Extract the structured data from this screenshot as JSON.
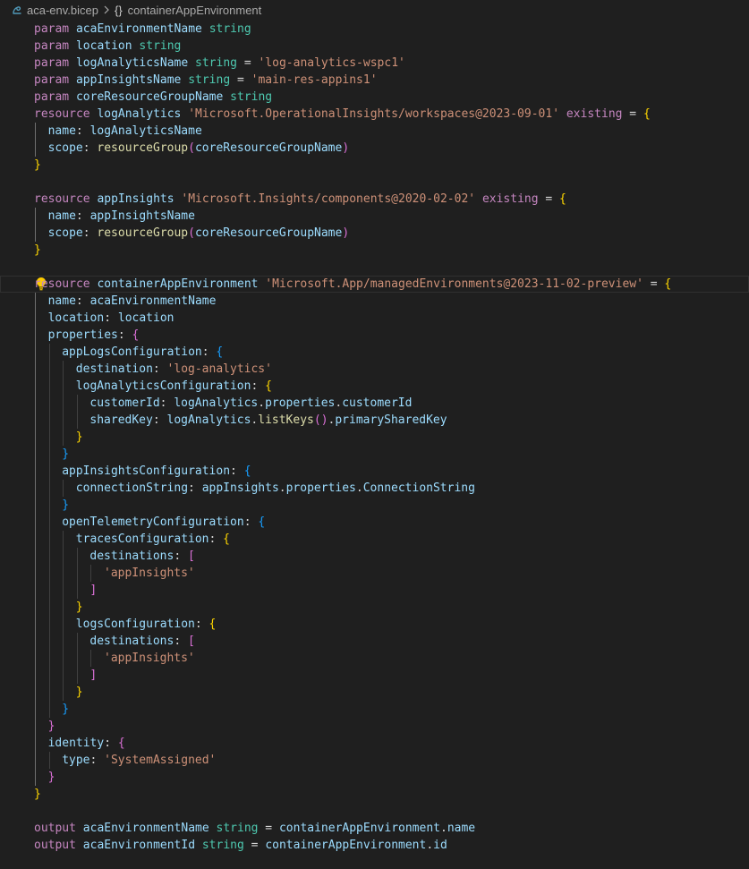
{
  "breadcrumb": {
    "file_icon": "bicep-file-icon",
    "file_name": "aca-env.bicep",
    "separator_icon": "chevron-right-icon",
    "symbol_icon_text": "{}",
    "symbol_name": "containerAppEnvironment"
  },
  "editor": {
    "theme_colors": {
      "background": "#1f1f1f",
      "keyword": "#C586C0",
      "identifier": "#9CDCFE",
      "type": "#4EC9B0",
      "string": "#CE9178",
      "function": "#DCDCAA",
      "bracket_gold": "#FFD700",
      "bracket_purple": "#DA70D6",
      "bracket_blue": "#179FFF"
    },
    "lightbulb_icon": "lightbulb-icon",
    "lines": [
      {
        "indent": 0,
        "tokens": [
          {
            "t": "param",
            "c": "kw"
          },
          {
            "t": " "
          },
          {
            "t": "acaEnvironmentName",
            "c": "id"
          },
          {
            "t": " "
          },
          {
            "t": "string",
            "c": "ty"
          }
        ]
      },
      {
        "indent": 0,
        "tokens": [
          {
            "t": "param",
            "c": "kw"
          },
          {
            "t": " "
          },
          {
            "t": "location",
            "c": "id"
          },
          {
            "t": " "
          },
          {
            "t": "string",
            "c": "ty"
          }
        ]
      },
      {
        "indent": 0,
        "tokens": [
          {
            "t": "param",
            "c": "kw"
          },
          {
            "t": " "
          },
          {
            "t": "logAnalyticsName",
            "c": "id"
          },
          {
            "t": " "
          },
          {
            "t": "string",
            "c": "ty"
          },
          {
            "t": " = ",
            "c": "op"
          },
          {
            "t": "'log-analytics-wspc1'",
            "c": "str"
          }
        ]
      },
      {
        "indent": 0,
        "tokens": [
          {
            "t": "param",
            "c": "kw"
          },
          {
            "t": " "
          },
          {
            "t": "appInsightsName",
            "c": "id"
          },
          {
            "t": " "
          },
          {
            "t": "string",
            "c": "ty"
          },
          {
            "t": " = ",
            "c": "op"
          },
          {
            "t": "'main-res-appins1'",
            "c": "str"
          }
        ]
      },
      {
        "indent": 0,
        "tokens": [
          {
            "t": "param",
            "c": "kw"
          },
          {
            "t": " "
          },
          {
            "t": "coreResourceGroupName",
            "c": "id"
          },
          {
            "t": " "
          },
          {
            "t": "string",
            "c": "ty"
          }
        ]
      },
      {
        "indent": 0,
        "tokens": [
          {
            "t": "resource",
            "c": "kw"
          },
          {
            "t": " "
          },
          {
            "t": "logAnalytics",
            "c": "id"
          },
          {
            "t": " "
          },
          {
            "t": "'Microsoft.OperationalInsights/workspaces@2023-09-01'",
            "c": "str"
          },
          {
            "t": " "
          },
          {
            "t": "existing",
            "c": "kw"
          },
          {
            "t": " = ",
            "c": "op"
          },
          {
            "t": "{",
            "c": "b1"
          }
        ]
      },
      {
        "indent": 1,
        "tokens": [
          {
            "t": "name",
            "c": "id"
          },
          {
            "t": ": ",
            "c": "op"
          },
          {
            "t": "logAnalyticsName",
            "c": "id"
          }
        ]
      },
      {
        "indent": 1,
        "tokens": [
          {
            "t": "scope",
            "c": "id"
          },
          {
            "t": ": ",
            "c": "op"
          },
          {
            "t": "resourceGroup",
            "c": "fn"
          },
          {
            "t": "(",
            "c": "b2"
          },
          {
            "t": "coreResourceGroupName",
            "c": "id"
          },
          {
            "t": ")",
            "c": "b2"
          }
        ]
      },
      {
        "indent": 0,
        "tokens": [
          {
            "t": "}",
            "c": "b1"
          }
        ]
      },
      {
        "indent": 0,
        "tokens": []
      },
      {
        "indent": 0,
        "tokens": [
          {
            "t": "resource",
            "c": "kw"
          },
          {
            "t": " "
          },
          {
            "t": "appInsights",
            "c": "id"
          },
          {
            "t": " "
          },
          {
            "t": "'Microsoft.Insights/components@2020-02-02'",
            "c": "str"
          },
          {
            "t": " "
          },
          {
            "t": "existing",
            "c": "kw"
          },
          {
            "t": " = ",
            "c": "op"
          },
          {
            "t": "{",
            "c": "b1"
          }
        ]
      },
      {
        "indent": 1,
        "tokens": [
          {
            "t": "name",
            "c": "id"
          },
          {
            "t": ": ",
            "c": "op"
          },
          {
            "t": "appInsightsName",
            "c": "id"
          }
        ]
      },
      {
        "indent": 1,
        "tokens": [
          {
            "t": "scope",
            "c": "id"
          },
          {
            "t": ": ",
            "c": "op"
          },
          {
            "t": "resourceGroup",
            "c": "fn"
          },
          {
            "t": "(",
            "c": "b2"
          },
          {
            "t": "coreResourceGroupName",
            "c": "id"
          },
          {
            "t": ")",
            "c": "b2"
          }
        ]
      },
      {
        "indent": 0,
        "tokens": [
          {
            "t": "}",
            "c": "b1"
          }
        ]
      },
      {
        "indent": 0,
        "tokens": [],
        "lightbulb": true
      },
      {
        "indent": 0,
        "current": true,
        "tokens": [
          {
            "t": "resource",
            "c": "kw"
          },
          {
            "t": " "
          },
          {
            "t": "containerAppEnvironment",
            "c": "id"
          },
          {
            "t": " "
          },
          {
            "t": "'Microsoft.App/managedEnvironments@2023-11-02-preview'",
            "c": "str"
          },
          {
            "t": " = ",
            "c": "op"
          },
          {
            "t": "{",
            "c": "b1"
          }
        ]
      },
      {
        "indent": 1,
        "tokens": [
          {
            "t": "name",
            "c": "id"
          },
          {
            "t": ": ",
            "c": "op"
          },
          {
            "t": "acaEnvironmentName",
            "c": "id"
          }
        ]
      },
      {
        "indent": 1,
        "tokens": [
          {
            "t": "location",
            "c": "id"
          },
          {
            "t": ": ",
            "c": "op"
          },
          {
            "t": "location",
            "c": "id"
          }
        ]
      },
      {
        "indent": 1,
        "tokens": [
          {
            "t": "properties",
            "c": "id"
          },
          {
            "t": ": ",
            "c": "op"
          },
          {
            "t": "{",
            "c": "b2"
          }
        ]
      },
      {
        "indent": 2,
        "tokens": [
          {
            "t": "appLogsConfiguration",
            "c": "id"
          },
          {
            "t": ": ",
            "c": "op"
          },
          {
            "t": "{",
            "c": "b3"
          }
        ]
      },
      {
        "indent": 3,
        "tokens": [
          {
            "t": "destination",
            "c": "id"
          },
          {
            "t": ": ",
            "c": "op"
          },
          {
            "t": "'log-analytics'",
            "c": "str"
          }
        ]
      },
      {
        "indent": 3,
        "tokens": [
          {
            "t": "logAnalyticsConfiguration",
            "c": "id"
          },
          {
            "t": ": ",
            "c": "op"
          },
          {
            "t": "{",
            "c": "b1"
          }
        ]
      },
      {
        "indent": 4,
        "tokens": [
          {
            "t": "customerId",
            "c": "id"
          },
          {
            "t": ": ",
            "c": "op"
          },
          {
            "t": "logAnalytics",
            "c": "id"
          },
          {
            "t": ".",
            "c": "op"
          },
          {
            "t": "properties",
            "c": "id"
          },
          {
            "t": ".",
            "c": "op"
          },
          {
            "t": "customerId",
            "c": "id"
          }
        ]
      },
      {
        "indent": 4,
        "tokens": [
          {
            "t": "sharedKey",
            "c": "id"
          },
          {
            "t": ": ",
            "c": "op"
          },
          {
            "t": "logAnalytics",
            "c": "id"
          },
          {
            "t": ".",
            "c": "op"
          },
          {
            "t": "listKeys",
            "c": "fn"
          },
          {
            "t": "()",
            "c": "b2"
          },
          {
            "t": ".",
            "c": "op"
          },
          {
            "t": "primarySharedKey",
            "c": "id"
          }
        ]
      },
      {
        "indent": 3,
        "tokens": [
          {
            "t": "}",
            "c": "b1"
          }
        ]
      },
      {
        "indent": 2,
        "tokens": [
          {
            "t": "}",
            "c": "b3"
          }
        ]
      },
      {
        "indent": 2,
        "tokens": [
          {
            "t": "appInsightsConfiguration",
            "c": "id"
          },
          {
            "t": ": ",
            "c": "op"
          },
          {
            "t": "{",
            "c": "b3"
          }
        ]
      },
      {
        "indent": 3,
        "tokens": [
          {
            "t": "connectionString",
            "c": "id"
          },
          {
            "t": ": ",
            "c": "op"
          },
          {
            "t": "appInsights",
            "c": "id"
          },
          {
            "t": ".",
            "c": "op"
          },
          {
            "t": "properties",
            "c": "id"
          },
          {
            "t": ".",
            "c": "op"
          },
          {
            "t": "ConnectionString",
            "c": "id"
          }
        ]
      },
      {
        "indent": 2,
        "tokens": [
          {
            "t": "}",
            "c": "b3"
          }
        ]
      },
      {
        "indent": 2,
        "tokens": [
          {
            "t": "openTelemetryConfiguration",
            "c": "id"
          },
          {
            "t": ": ",
            "c": "op"
          },
          {
            "t": "{",
            "c": "b3"
          }
        ]
      },
      {
        "indent": 3,
        "tokens": [
          {
            "t": "tracesConfiguration",
            "c": "id"
          },
          {
            "t": ": ",
            "c": "op"
          },
          {
            "t": "{",
            "c": "b1"
          }
        ]
      },
      {
        "indent": 4,
        "tokens": [
          {
            "t": "destinations",
            "c": "id"
          },
          {
            "t": ": ",
            "c": "op"
          },
          {
            "t": "[",
            "c": "b2"
          }
        ]
      },
      {
        "indent": 5,
        "tokens": [
          {
            "t": "'appInsights'",
            "c": "str"
          }
        ]
      },
      {
        "indent": 4,
        "tokens": [
          {
            "t": "]",
            "c": "b2"
          }
        ]
      },
      {
        "indent": 3,
        "tokens": [
          {
            "t": "}",
            "c": "b1"
          }
        ]
      },
      {
        "indent": 3,
        "tokens": [
          {
            "t": "logsConfiguration",
            "c": "id"
          },
          {
            "t": ": ",
            "c": "op"
          },
          {
            "t": "{",
            "c": "b1"
          }
        ]
      },
      {
        "indent": 4,
        "tokens": [
          {
            "t": "destinations",
            "c": "id"
          },
          {
            "t": ": ",
            "c": "op"
          },
          {
            "t": "[",
            "c": "b2"
          }
        ]
      },
      {
        "indent": 5,
        "tokens": [
          {
            "t": "'appInsights'",
            "c": "str"
          }
        ]
      },
      {
        "indent": 4,
        "tokens": [
          {
            "t": "]",
            "c": "b2"
          }
        ]
      },
      {
        "indent": 3,
        "tokens": [
          {
            "t": "}",
            "c": "b1"
          }
        ]
      },
      {
        "indent": 2,
        "tokens": [
          {
            "t": "}",
            "c": "b3"
          }
        ]
      },
      {
        "indent": 1,
        "tokens": [
          {
            "t": "}",
            "c": "b2"
          }
        ]
      },
      {
        "indent": 1,
        "tokens": [
          {
            "t": "identity",
            "c": "id"
          },
          {
            "t": ": ",
            "c": "op"
          },
          {
            "t": "{",
            "c": "b2"
          }
        ]
      },
      {
        "indent": 2,
        "tokens": [
          {
            "t": "type",
            "c": "id"
          },
          {
            "t": ": ",
            "c": "op"
          },
          {
            "t": "'SystemAssigned'",
            "c": "str"
          }
        ]
      },
      {
        "indent": 1,
        "tokens": [
          {
            "t": "}",
            "c": "b2"
          }
        ]
      },
      {
        "indent": 0,
        "tokens": [
          {
            "t": "}",
            "c": "b1"
          }
        ]
      },
      {
        "indent": 0,
        "tokens": []
      },
      {
        "indent": 0,
        "tokens": [
          {
            "t": "output",
            "c": "kw"
          },
          {
            "t": " "
          },
          {
            "t": "acaEnvironmentName",
            "c": "id"
          },
          {
            "t": " "
          },
          {
            "t": "string",
            "c": "ty"
          },
          {
            "t": " = ",
            "c": "op"
          },
          {
            "t": "containerAppEnvironment",
            "c": "id"
          },
          {
            "t": ".",
            "c": "op"
          },
          {
            "t": "name",
            "c": "id"
          }
        ]
      },
      {
        "indent": 0,
        "tokens": [
          {
            "t": "output",
            "c": "kw"
          },
          {
            "t": " "
          },
          {
            "t": "acaEnvironmentId",
            "c": "id"
          },
          {
            "t": " "
          },
          {
            "t": "string",
            "c": "ty"
          },
          {
            "t": " = ",
            "c": "op"
          },
          {
            "t": "containerAppEnvironment",
            "c": "id"
          },
          {
            "t": ".",
            "c": "op"
          },
          {
            "t": "id",
            "c": "id"
          }
        ]
      }
    ]
  }
}
